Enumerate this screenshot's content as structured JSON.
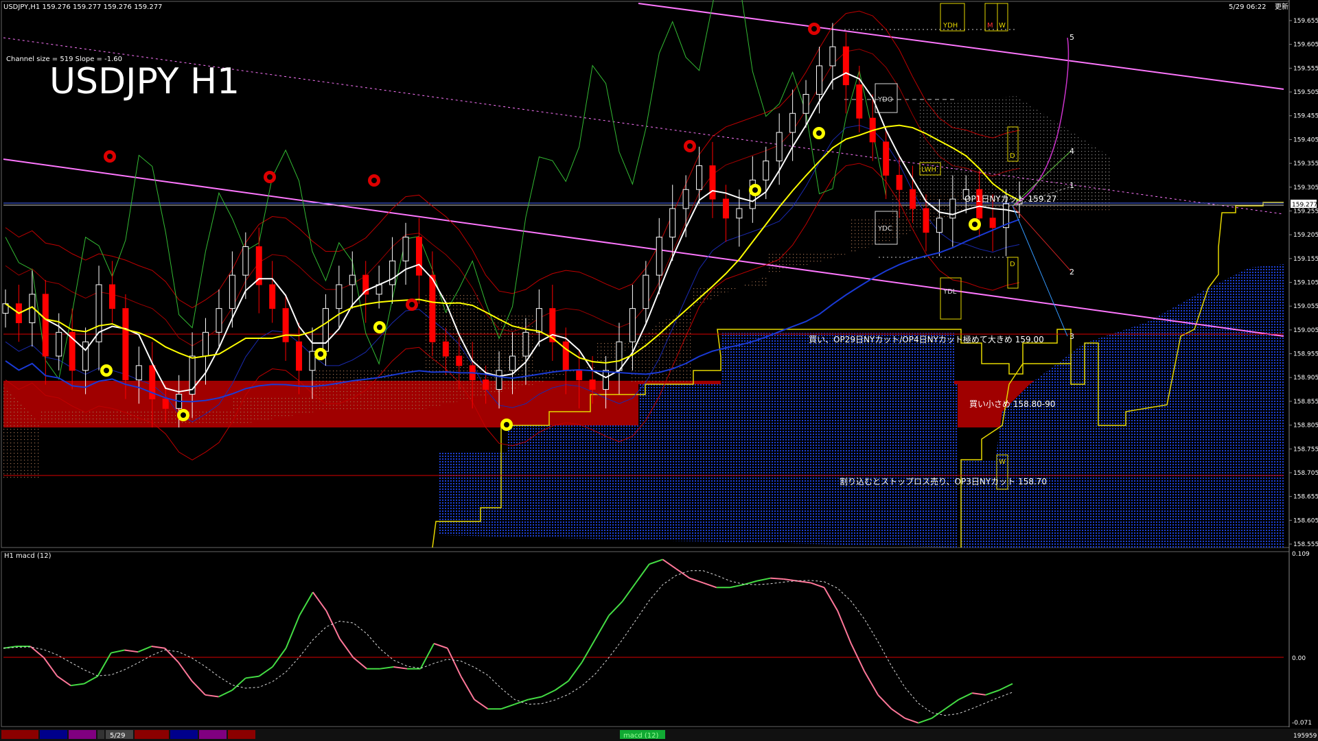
{
  "header": {
    "symbol_line": "USDJPY,H1  159.276 159.277 159.276 159.277",
    "datetime": "5/29 06:22",
    "datetime_suffix": "更新",
    "channel_info": "Channel size = 519 Slope = -1.60",
    "big_title": "USDJPY H1"
  },
  "price_axis": {
    "ticks": [
      "159.655",
      "159.605",
      "159.555",
      "159.505",
      "159.455",
      "159.405",
      "159.355",
      "159.305",
      "159.255",
      "159.205",
      "159.155",
      "159.105",
      "159.055",
      "159.005",
      "158.955",
      "158.905",
      "158.855",
      "158.805",
      "158.755",
      "158.705",
      "158.655",
      "158.605",
      "158.555"
    ],
    "current_price": "159.277"
  },
  "day_labels": {
    "ydh": "YDH",
    "m": "M",
    "w": "W",
    "ydo": "YDO",
    "lwh": "LWH",
    "ydc": "YDC",
    "ydl": "YDL",
    "d_upper": "D",
    "d_lower": "D",
    "w_lower": "W"
  },
  "projection_labels": [
    "5",
    "4",
    "1",
    "2",
    "3"
  ],
  "annotations": {
    "op1": "OP1日NYカット 159.27",
    "buy_159": "買い、OP29日NYカット/OP4日NYカット極めて大きめ 159.00",
    "buy_small": "買い小さめ 158.80-90",
    "stop_loss": "割り込むとストップロス売り、OP3日NYカット 158.70"
  },
  "macd_panel": {
    "label": "H1  macd (12)",
    "ticks": [
      "0.109",
      "0.00",
      "-0.071"
    ]
  },
  "footer": {
    "date_tab": "5/29",
    "center_label": "macd (12)",
    "right_label": "195959"
  },
  "colors": {
    "background": "#000000",
    "candle_up": "#ffffff",
    "candle_down": "#ff0000",
    "cloud_red": "#9b0000",
    "cloud_blue": "#1a3ad6",
    "channel": "#ff77ff",
    "ma_white": "#ffffff",
    "ma_yellow": "#ffff00",
    "ma_blue": "#1a3ad6",
    "macd_up": "#44dd44",
    "macd_down": "#ff7799"
  },
  "chart_data": {
    "type": "line",
    "title": "USDJPY H1",
    "timeframe": "H1",
    "price_range": [
      158.555,
      159.655
    ],
    "current_price": 159.277,
    "levels": [
      {
        "price": 159.27,
        "label": "OP1日NYカット 159.27"
      },
      {
        "price": 159.0,
        "label": "買い、OP29日NYカット/OP4日NYカット極めて大きめ 159.00"
      },
      {
        "price_range": [
          158.8,
          158.9
        ],
        "label": "買い小さめ 158.80-90"
      },
      {
        "price": 158.7,
        "label": "割り込むとストップロス売り、OP3日NYカット 158.70"
      }
    ],
    "close_series": [
      159.06,
      159.02,
      159.08,
      158.95,
      159.0,
      158.92,
      158.98,
      159.1,
      159.05,
      158.9,
      158.93,
      158.86,
      158.84,
      158.87,
      158.95,
      159.0,
      159.05,
      159.12,
      159.18,
      159.1,
      159.05,
      158.98,
      158.92,
      158.96,
      159.05,
      159.1,
      159.12,
      159.08,
      159.1,
      159.15,
      159.2,
      159.12,
      158.98,
      158.95,
      158.93,
      158.9,
      158.88,
      158.92,
      158.95,
      159.0,
      159.05,
      158.98,
      158.92,
      158.9,
      158.88,
      158.92,
      158.98,
      159.05,
      159.12,
      159.2,
      159.26,
      159.3,
      159.35,
      159.28,
      159.24,
      159.26,
      159.32,
      159.36,
      159.42,
      159.46,
      159.5,
      159.56,
      159.6,
      159.52,
      159.45,
      159.4,
      159.33,
      159.3,
      159.26,
      159.21,
      159.24,
      159.28,
      159.3,
      159.24,
      159.22,
      159.27,
      159.277
    ],
    "macd": {
      "range": [
        -0.071,
        0.109
      ],
      "values": [
        0.01,
        0.012,
        0.012,
        0.0,
        -0.02,
        -0.03,
        -0.028,
        -0.02,
        0.005,
        0.008,
        0.006,
        0.012,
        0.01,
        -0.005,
        -0.025,
        -0.04,
        -0.042,
        -0.035,
        -0.022,
        -0.02,
        -0.01,
        0.01,
        0.045,
        0.07,
        0.05,
        0.02,
        0.0,
        -0.012,
        -0.012,
        -0.01,
        -0.012,
        -0.012,
        0.015,
        0.01,
        -0.02,
        -0.045,
        -0.055,
        -0.055,
        -0.05,
        -0.045,
        -0.042,
        -0.035,
        -0.025,
        -0.005,
        0.02,
        0.045,
        0.06,
        0.08,
        0.1,
        0.105,
        0.095,
        0.085,
        0.08,
        0.075,
        0.075,
        0.078,
        0.082,
        0.085,
        0.084,
        0.082,
        0.08,
        0.075,
        0.05,
        0.015,
        -0.015,
        -0.04,
        -0.055,
        -0.065,
        -0.07,
        -0.065,
        -0.055,
        -0.045,
        -0.038,
        -0.04,
        -0.035,
        -0.028
      ]
    }
  }
}
